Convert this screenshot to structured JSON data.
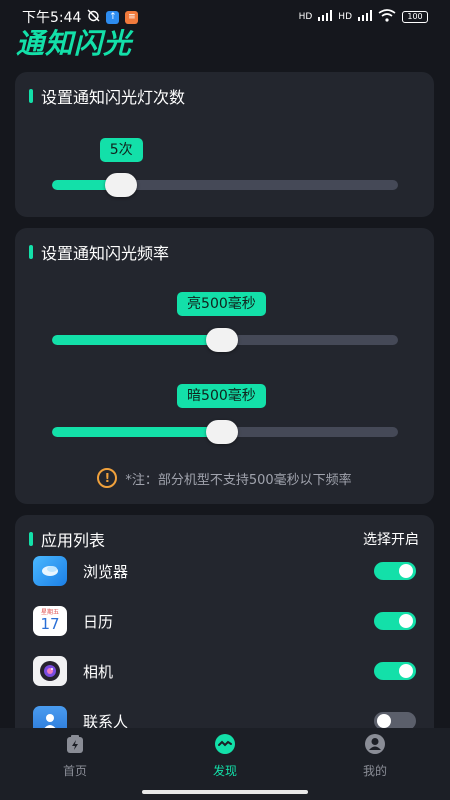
{
  "status_bar": {
    "time": "下午5:44",
    "network_labels": [
      "HD",
      "HD"
    ],
    "battery": "100"
  },
  "app": {
    "title": "通知闪光"
  },
  "flash_count": {
    "title": "设置通知闪光灯次数",
    "value_label": "5次",
    "value_fraction": 0.2
  },
  "flash_frequency": {
    "title": "设置通知闪光频率",
    "bright": {
      "label": "亮500毫秒",
      "value_fraction": 0.49
    },
    "dark": {
      "label": "暗500毫秒",
      "value_fraction": 0.49
    },
    "note": "*注：部分机型不支持500毫秒以下频率"
  },
  "app_list": {
    "title": "应用列表",
    "action": "选择开启",
    "items": [
      {
        "name": "浏览器",
        "icon": "browser-icon",
        "enabled": true
      },
      {
        "name": "日历",
        "icon": "calendar-icon",
        "enabled": true,
        "icon_weekday": "星期五",
        "icon_day": "17"
      },
      {
        "name": "相机",
        "icon": "camera-icon",
        "enabled": true
      },
      {
        "name": "联系人",
        "icon": "contacts-icon",
        "enabled": false
      }
    ]
  },
  "bottom_nav": {
    "items": [
      {
        "label": "首页",
        "icon": "home-icon",
        "active": false
      },
      {
        "label": "发现",
        "icon": "discover-icon",
        "active": true
      },
      {
        "label": "我的",
        "icon": "profile-icon",
        "active": false
      }
    ]
  },
  "colors": {
    "accent": "#13e0a9",
    "background": "#15171d",
    "card": "#23262e",
    "warning": "#f0a13c"
  }
}
